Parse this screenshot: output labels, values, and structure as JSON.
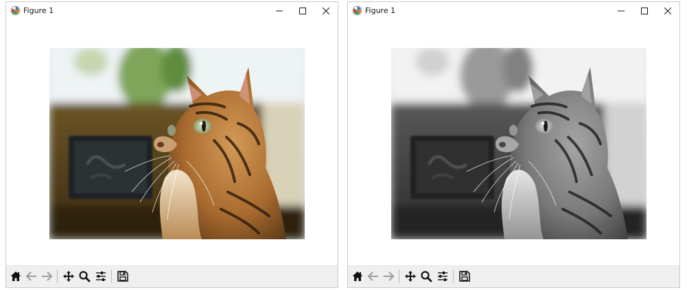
{
  "windows": [
    {
      "title": "Figure 1",
      "image": {
        "variant": "color",
        "subject": "tabby cat looking up"
      }
    },
    {
      "title": "Figure 1",
      "image": {
        "variant": "grayscale",
        "subject": "tabby cat looking up"
      }
    }
  ],
  "window_controls": [
    "minimize-icon",
    "maximize-icon",
    "close-icon"
  ],
  "toolbar": {
    "buttons": [
      {
        "name": "home-icon"
      },
      {
        "name": "back-arrow-icon"
      },
      {
        "name": "forward-arrow-icon"
      },
      {
        "name": "pan-icon"
      },
      {
        "name": "zoom-icon"
      },
      {
        "name": "configure-subplots-icon"
      },
      {
        "name": "save-icon"
      }
    ]
  },
  "colors": {
    "toolbar_bg": "#efefef",
    "window_border": "#c9c9c9",
    "cat_fur": "#a86a2e",
    "background_blur": "#6b4a22"
  }
}
